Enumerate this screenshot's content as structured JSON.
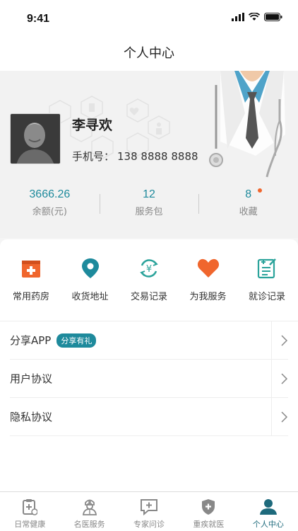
{
  "status": {
    "time": "9:41"
  },
  "nav": {
    "title": "个人中心"
  },
  "user": {
    "name": "李寻欢",
    "phone_label": "手机号：",
    "phone": "138 8888 8888"
  },
  "stats": [
    {
      "value": "3666.26",
      "label": "余额(元)"
    },
    {
      "value": "12",
      "label": "服务包"
    },
    {
      "value": "8",
      "label": "收藏"
    }
  ],
  "quick": [
    {
      "label": "常用药房",
      "icon": "pharmacy-icon",
      "color": "#f0662d"
    },
    {
      "label": "收货地址",
      "icon": "location-icon",
      "color": "#1e8a9c"
    },
    {
      "label": "交易记录",
      "icon": "transaction-icon",
      "color": "#2ba39b"
    },
    {
      "label": "为我服务",
      "icon": "heart-icon",
      "color": "#f0662d"
    },
    {
      "label": "就诊记录",
      "icon": "record-icon",
      "color": "#2ba39b"
    }
  ],
  "list": [
    {
      "label": "分享APP",
      "badge": "分享有礼"
    },
    {
      "label": "用户协议"
    },
    {
      "label": "隐私协议"
    }
  ],
  "tabs": [
    {
      "label": "日常健康",
      "icon": "clipboard-icon"
    },
    {
      "label": "名医服务",
      "icon": "doctor-icon"
    },
    {
      "label": "专家问诊",
      "icon": "consult-icon"
    },
    {
      "label": "重疾就医",
      "icon": "shield-icon"
    },
    {
      "label": "个人中心",
      "icon": "person-icon",
      "active": true
    }
  ],
  "colors": {
    "accent": "#1e8a9c",
    "orange": "#f0662d",
    "tab_active": "#1e6a7c"
  }
}
